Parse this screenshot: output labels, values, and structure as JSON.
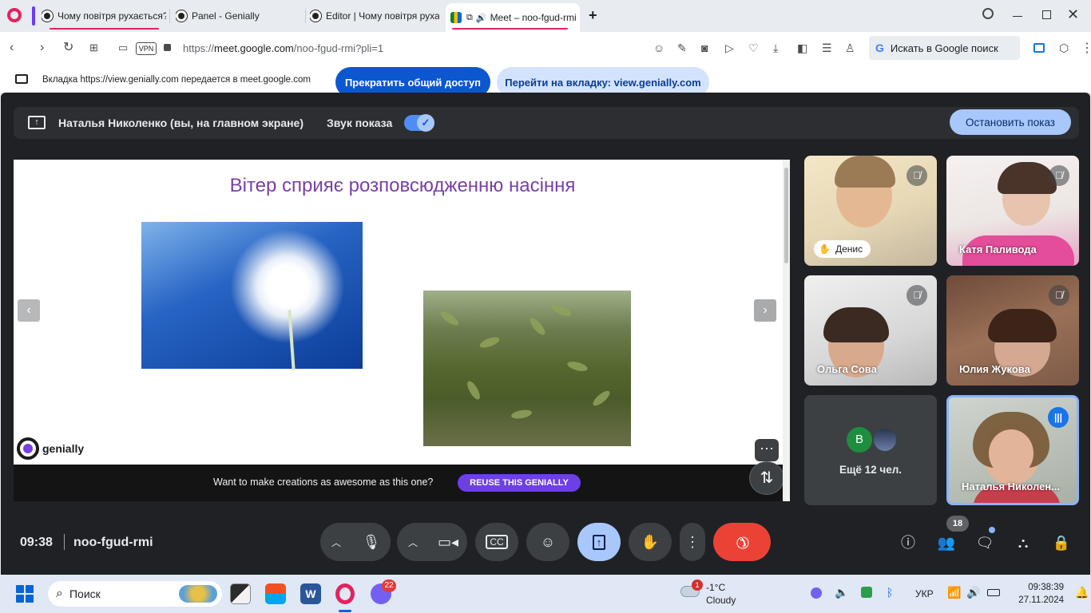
{
  "browser": {
    "tabs": [
      {
        "label": "Чому повітря рухається?"
      },
      {
        "label": "Panel - Genially"
      },
      {
        "label": "Editor | Чому повітря рухається?"
      },
      {
        "label": "Meet – noo-fgud-rmi"
      }
    ],
    "new_tab": "+",
    "vpn": "VPN",
    "url_prefix": "https://",
    "url_host": "meet.google.com",
    "url_path": "/noo-fgud-rmi?pli=1",
    "search_placeholder": "Искать в Google поиск",
    "search_g": "G"
  },
  "share_banner": {
    "text": "Вкладка https://view.genially.com передается в meet.google.com",
    "stop_button": "Прекратить общий доступ",
    "go_button": "Перейти на вкладку: view.genially.com"
  },
  "presentation_bar": {
    "presenter": "Наталья Николенко (вы, на главном экране)",
    "sound_label": "Звук показа",
    "sound_on": true,
    "stop_button": "Остановить показ"
  },
  "slide": {
    "title": "Вітер сприяє розповсюдженню насіння",
    "logo_word": "genially",
    "footer_text": "Want to make creations as awesome as this one?",
    "reuse_button": "REUSE THIS GENIALLY",
    "more": "···"
  },
  "participants": [
    {
      "name": "Денис",
      "muted": true,
      "hand_raised": true
    },
    {
      "name": "Катя Паливода",
      "muted": true
    },
    {
      "name": "Ольга Сова",
      "muted": true
    },
    {
      "name": "Юлия Жукова",
      "muted": true
    },
    {
      "name": "Ещё 12 чел.",
      "avatar_letter": "В"
    },
    {
      "name": "Наталья Николен...",
      "speaking": true
    }
  ],
  "meeting": {
    "time": "09:38",
    "code": "noo-fgud-rmi",
    "people_count": "18"
  },
  "taskbar": {
    "search": "Поиск",
    "viber_badge": "22",
    "weather_badge": "1",
    "temperature": "-1°C",
    "weather_text": "Cloudy",
    "language": "УКР",
    "time": "09:38:39",
    "date": "27.11.2024"
  },
  "colors": {
    "accent": "#0b57d0",
    "meet_bg": "#202124",
    "present_btn": "#a8c7fa",
    "hangup": "#ea4335",
    "slide_title": "#7a3fa8",
    "reuse": "#6c3fe8"
  }
}
